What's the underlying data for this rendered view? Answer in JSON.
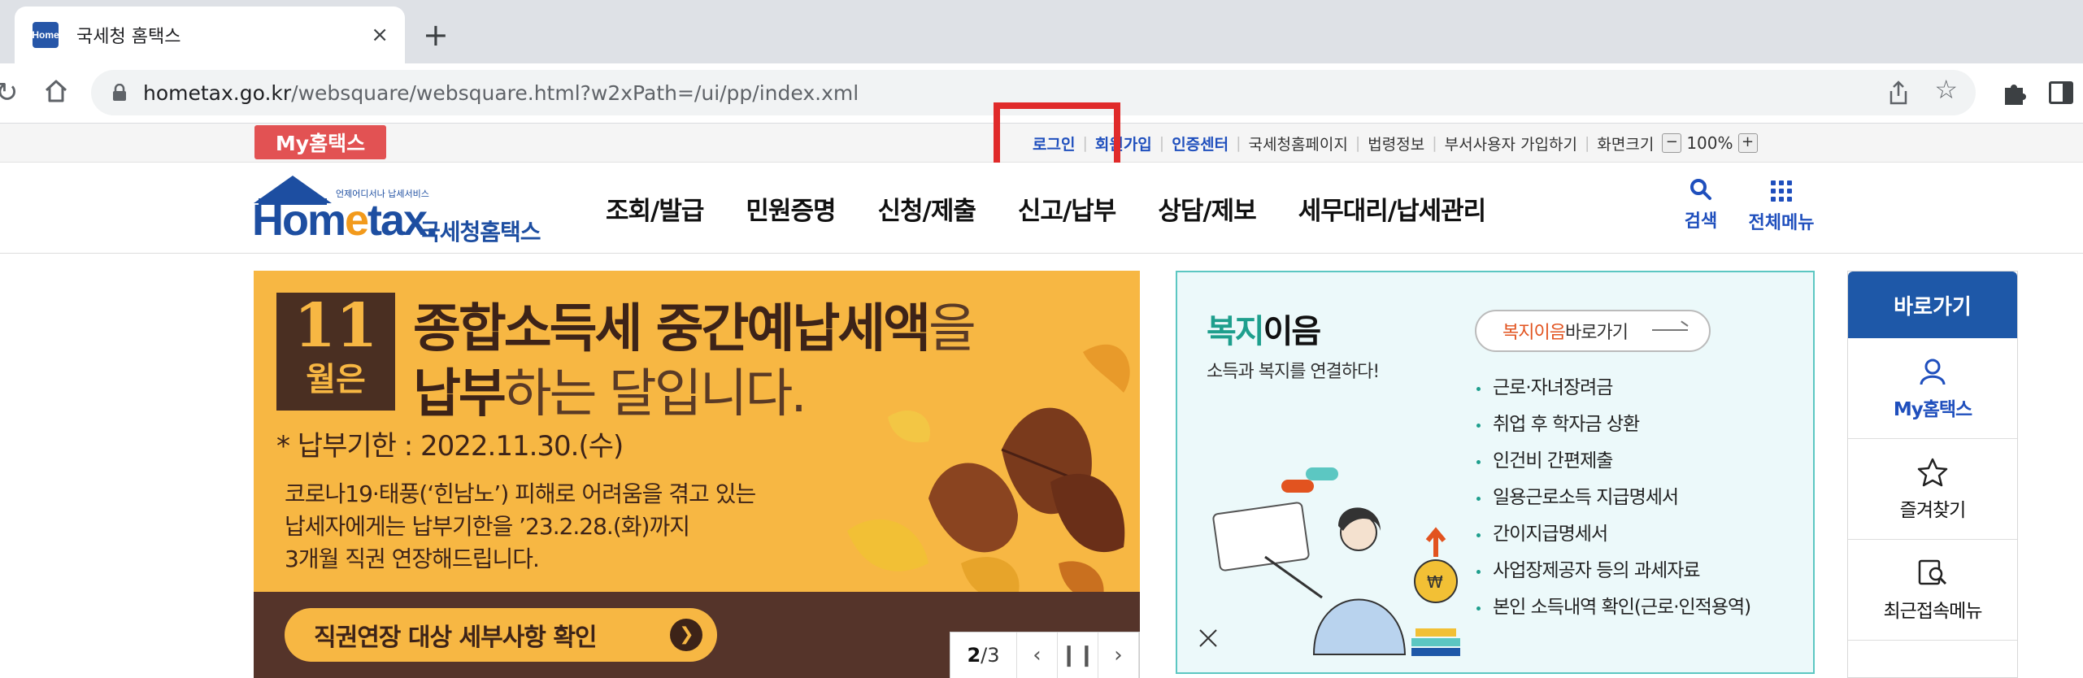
{
  "browser": {
    "tab_title": "국세청 홈택스",
    "favicon_text": "Home",
    "new_tab": "+",
    "close": "×",
    "url_host": "hometax.go.kr",
    "url_path": "/websquare/websquare.html?w2xPath=/ui/pp/index.xml"
  },
  "utilbar": {
    "my_hometax": "My홈택스",
    "login": "로그인",
    "signup": "회원가입",
    "cert_center": "인증센터",
    "nts_homepage": "국세청홈페이지",
    "law_info": "법령정보",
    "dept_user_signup": "부서사용자 가입하기",
    "screen_size": "화면크기",
    "zoom_minus": "−",
    "zoom_value": "100%",
    "zoom_plus": "+"
  },
  "header": {
    "logo_tagline": "언제어디서나 납세서비스",
    "logo_word_a": "Hom",
    "logo_word_e": "e",
    "logo_word_b": "tax.",
    "logo_korean": "국세청홈택스",
    "nav": [
      "조회/발급",
      "민원증명",
      "신청/제출",
      "신고/납부",
      "상담/제보",
      "세무대리/납세관리"
    ],
    "search": "검색",
    "all_menu": "전체메뉴"
  },
  "banner": {
    "month_num": "11",
    "month_unit": "월은",
    "line1_bold": "종합소득세 중간예납세액",
    "line1_thin": "을",
    "line2_bold": "납부",
    "line2_thin": "하는 달입니다.",
    "deadline": "* 납부기한 : 2022.11.30.(수)",
    "notice_1": "코로나19·태풍(‘힌남노’) 피해로 어려움을 겪고 있는",
    "notice_2": "납세자에게는 납부기한을 ’23.2.28.(화)까지",
    "notice_3": "3개월 직권 연장해드립니다.",
    "cta": "직권연장 대상 세부사항 확인",
    "pager_current": "2",
    "pager_total": "/3"
  },
  "welfare": {
    "title_accent": "복지",
    "title_rest": "이음",
    "subtitle": "소득과 복지를 연결하다!",
    "go_accent": "복지이음",
    "go_rest": " 바로가기",
    "items": [
      "근로·자녀장려금",
      "취업 후 학자금 상환",
      "인건비 간편제출",
      "일용근로소득 지급명세서",
      "간이지급명세서",
      "사업장제공자 등의 과세자료",
      "본인 소득내역 확인(근로·인적용역)"
    ]
  },
  "quick": {
    "title": "바로가기",
    "items": [
      "My홈택스",
      "즐겨찾기",
      "최근접속메뉴"
    ]
  },
  "colors": {
    "brand_blue": "#1d4ea1",
    "banner_orange": "#f7b743",
    "banner_brown": "#55342a",
    "welfare_teal": "#1e9f8d",
    "highlight_red": "#e02a2a",
    "my_badge_red": "#e25253"
  }
}
